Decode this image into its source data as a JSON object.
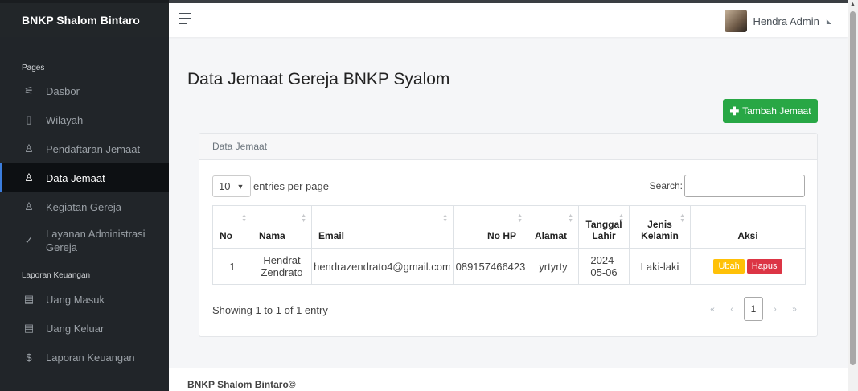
{
  "sidebar": {
    "brand": "BNKP Shalom Bintaro",
    "section_pages": "Pages",
    "section_finance": "Laporan Keuangan",
    "items": [
      {
        "label": "Dasbor",
        "icon": "sliders-icon",
        "glyph": "⚟"
      },
      {
        "label": "Wilayah",
        "icon": "map-icon",
        "glyph": "▯"
      },
      {
        "label": "Pendaftaran Jemaat",
        "icon": "user-check-icon",
        "glyph": "♙"
      },
      {
        "label": "Data Jemaat",
        "icon": "user-icon",
        "glyph": "♙"
      },
      {
        "label": "Kegiatan Gereja",
        "icon": "user-icon",
        "glyph": "♙"
      },
      {
        "label": "Layanan Administrasi Gereja",
        "icon": "check-circle-icon",
        "glyph": "✓"
      }
    ],
    "finance_items": [
      {
        "label": "Uang Masuk",
        "icon": "layout-icon",
        "glyph": "▤"
      },
      {
        "label": "Uang Keluar",
        "icon": "layout-icon",
        "glyph": "▤"
      },
      {
        "label": "Laporan Keuangan",
        "icon": "dollar-icon",
        "glyph": "$"
      }
    ],
    "active_index": 3
  },
  "topbar": {
    "user_name": "Hendra Admin"
  },
  "main": {
    "title": "Data Jemaat Gereja BNKP Syalom",
    "add_button": "Tambah Jemaat",
    "card_title": "Data Jemaat",
    "entries_value": "10",
    "entries_label": "entries per page",
    "search_label": "Search:",
    "columns": [
      "No",
      "Nama",
      "Email",
      "No HP",
      "Alamat",
      "Tanggal Lahir",
      "Jenis Kelamin",
      "Aksi"
    ],
    "rows": [
      {
        "no": "1",
        "nama": "Hendrat Zendrato",
        "email": "hendrazendrato4@gmail.com",
        "hp": "089157466423",
        "alamat": "yrtyrty",
        "lahir": "2024-05-06",
        "kelamin": "Laki-laki",
        "ubah": "Ubah",
        "hapus": "Hapus"
      }
    ],
    "showing": "Showing 1 to 1 of 1 entry",
    "pager": {
      "first": "«",
      "prev": "‹",
      "current": "1",
      "next": "›",
      "last": "»"
    }
  },
  "footer": {
    "text": "BNKP Shalom Bintaro©"
  },
  "colors": {
    "sidebar_bg": "#212529",
    "add_button": "#28a745",
    "edit_button": "#ffc107",
    "delete_button": "#dc3545",
    "active_accent": "#3b7ddd"
  }
}
